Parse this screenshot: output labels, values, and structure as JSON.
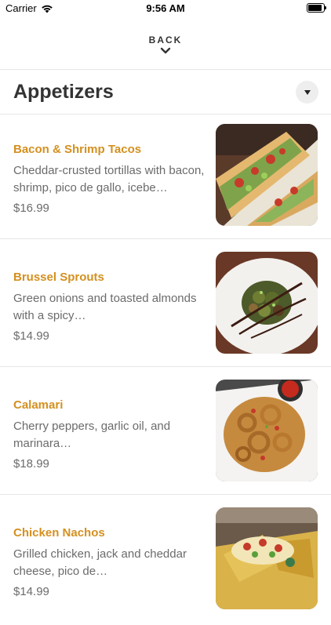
{
  "status_bar": {
    "carrier": "Carrier",
    "time": "9:56 AM"
  },
  "nav": {
    "back_label": "BACK"
  },
  "section": {
    "title": "Appetizers"
  },
  "items": [
    {
      "name": "Bacon & Shrimp Tacos",
      "description": "Cheddar-crusted tortillas with bacon, shrimp, pico de gallo, icebe…",
      "price": "$16.99"
    },
    {
      "name": "Brussel Sprouts",
      "description": "Green onions and toasted almonds with a spicy…",
      "price": "$14.99"
    },
    {
      "name": "Calamari",
      "description": "Cherry peppers, garlic oil, and marinara…",
      "price": "$18.99"
    },
    {
      "name": "Chicken Nachos",
      "description": "Grilled chicken, jack and cheddar cheese, pico de…",
      "price": "$14.99"
    }
  ],
  "colors": {
    "item_name": "#d4901f",
    "item_text": "#6b6b6b",
    "divider": "#e6e6e6"
  }
}
